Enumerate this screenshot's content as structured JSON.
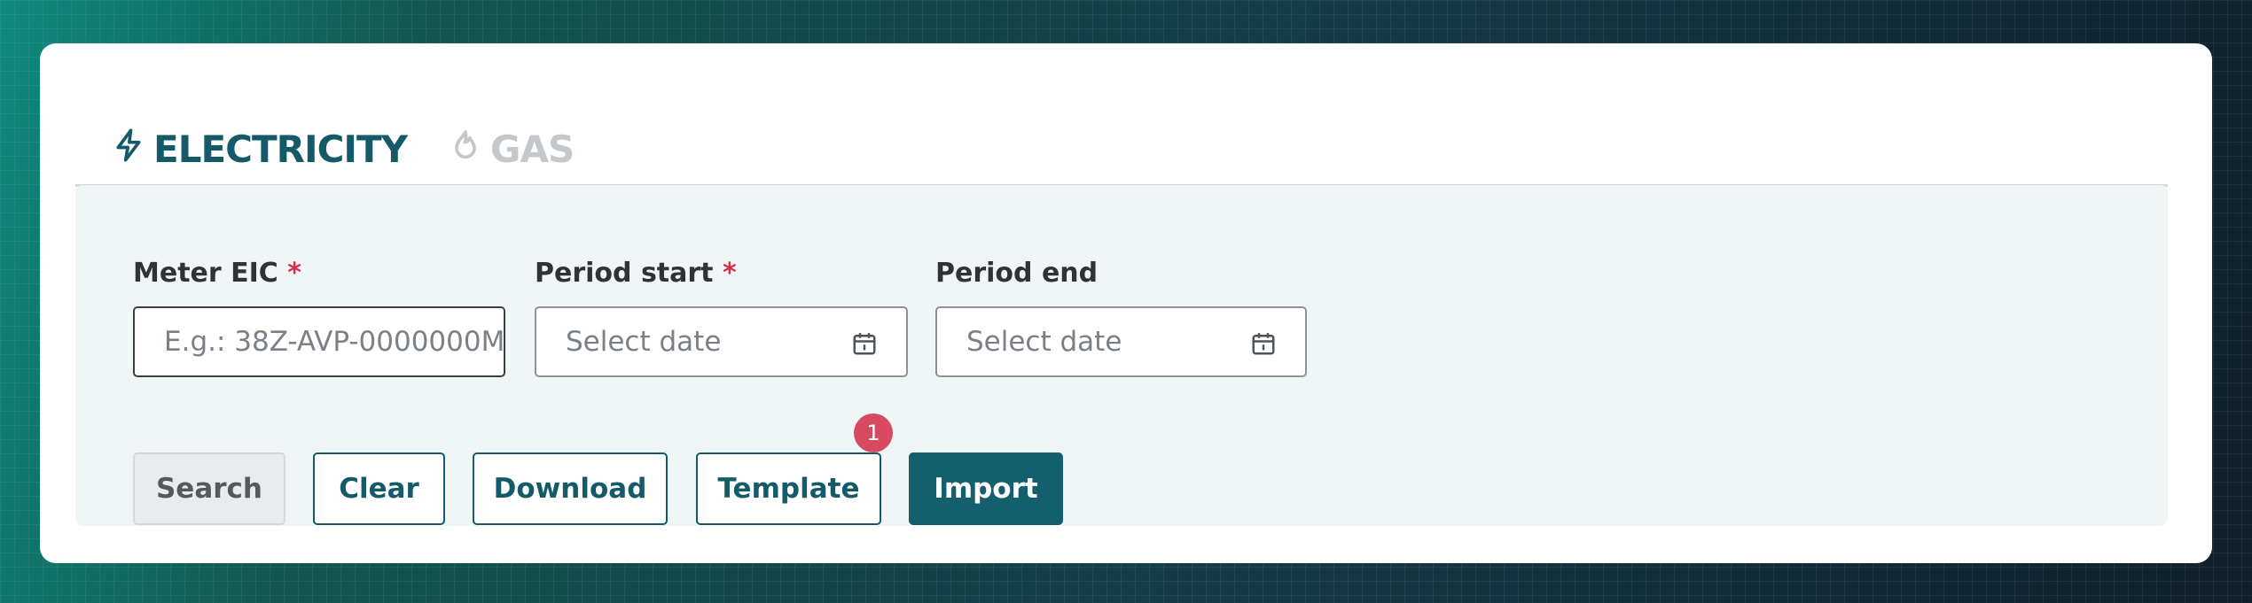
{
  "tabs": [
    {
      "label": "ELECTRICITY",
      "icon": "lightning-icon",
      "active": true
    },
    {
      "label": "GAS",
      "icon": "flame-icon",
      "active": false
    }
  ],
  "filters": {
    "meter_eic": {
      "label": "Meter EIC",
      "required_mark": "*",
      "placeholder": "E.g.: 38Z-AVP-0000000M",
      "value": ""
    },
    "period_start": {
      "label": "Period start",
      "required_mark": "*",
      "placeholder": "Select date",
      "icon": "calendar-icon"
    },
    "period_end": {
      "label": "Period end",
      "placeholder": "Select date",
      "icon": "calendar-icon"
    }
  },
  "actions": {
    "search": "Search",
    "clear": "Clear",
    "download": "Download",
    "template": "Template",
    "template_badge": "1",
    "import": "Import"
  },
  "colors": {
    "primary": "#155a68",
    "required": "#d72f45",
    "badge": "#d84a62",
    "panel_bg": "#f0f6f6"
  }
}
